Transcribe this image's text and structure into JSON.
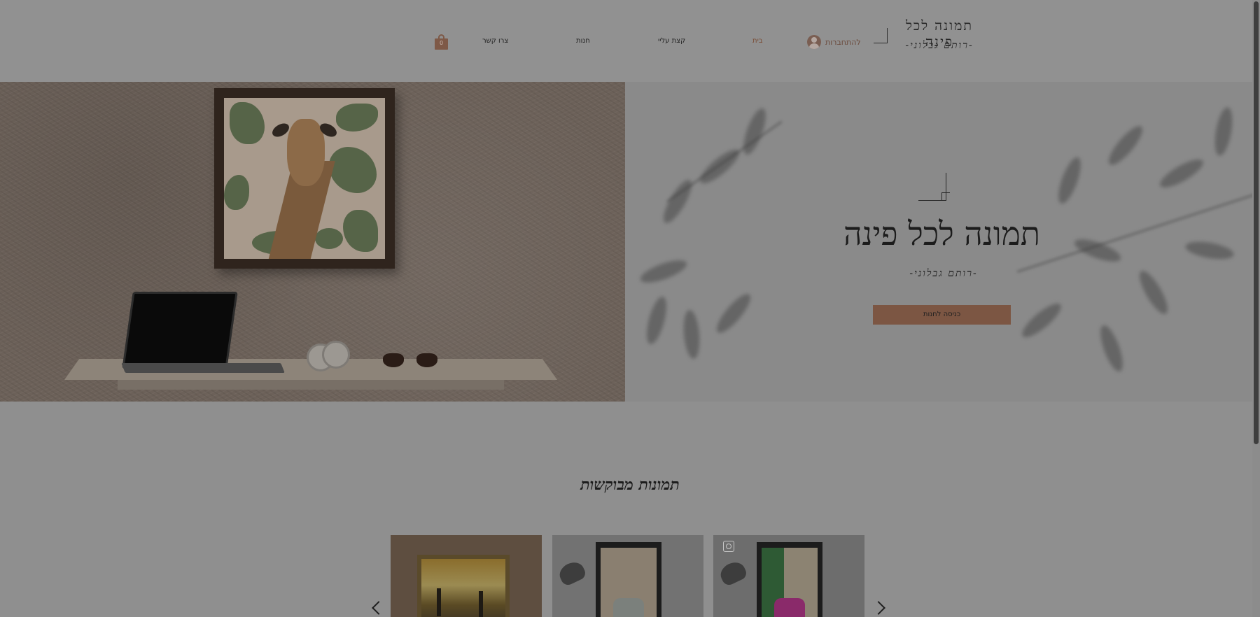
{
  "header": {
    "brand_title": "תמונה לכל פינה",
    "brand_subtitle": "-רותם גבלוני-",
    "login_label": "להתחברות",
    "nav": [
      {
        "label": "בית",
        "active": true
      },
      {
        "label": "קצת עליי",
        "active": false
      },
      {
        "label": "חנות",
        "active": false
      },
      {
        "label": "צרו קשר",
        "active": false
      }
    ],
    "cart_count": "0"
  },
  "hero": {
    "title": "תמונה לכל פינה",
    "subtitle": "-רותם גבלוני-",
    "button_label": "כניסה לחנות"
  },
  "featured": {
    "title": "תמונות מבוקשות"
  },
  "colors": {
    "accent": "#7c5643",
    "overlay_background": "#8f8f8f"
  }
}
